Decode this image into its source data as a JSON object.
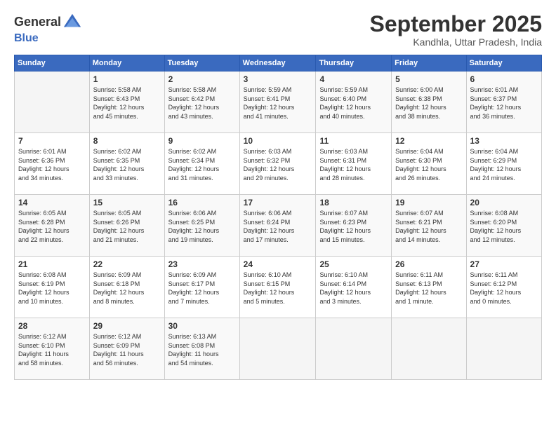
{
  "header": {
    "logo_line1": "General",
    "logo_line2": "Blue",
    "title": "September 2025",
    "location": "Kandhla, Uttar Pradesh, India"
  },
  "weekdays": [
    "Sunday",
    "Monday",
    "Tuesday",
    "Wednesday",
    "Thursday",
    "Friday",
    "Saturday"
  ],
  "weeks": [
    [
      {
        "day": "",
        "content": ""
      },
      {
        "day": "1",
        "content": "Sunrise: 5:58 AM\nSunset: 6:43 PM\nDaylight: 12 hours\nand 45 minutes."
      },
      {
        "day": "2",
        "content": "Sunrise: 5:58 AM\nSunset: 6:42 PM\nDaylight: 12 hours\nand 43 minutes."
      },
      {
        "day": "3",
        "content": "Sunrise: 5:59 AM\nSunset: 6:41 PM\nDaylight: 12 hours\nand 41 minutes."
      },
      {
        "day": "4",
        "content": "Sunrise: 5:59 AM\nSunset: 6:40 PM\nDaylight: 12 hours\nand 40 minutes."
      },
      {
        "day": "5",
        "content": "Sunrise: 6:00 AM\nSunset: 6:38 PM\nDaylight: 12 hours\nand 38 minutes."
      },
      {
        "day": "6",
        "content": "Sunrise: 6:01 AM\nSunset: 6:37 PM\nDaylight: 12 hours\nand 36 minutes."
      }
    ],
    [
      {
        "day": "7",
        "content": "Sunrise: 6:01 AM\nSunset: 6:36 PM\nDaylight: 12 hours\nand 34 minutes."
      },
      {
        "day": "8",
        "content": "Sunrise: 6:02 AM\nSunset: 6:35 PM\nDaylight: 12 hours\nand 33 minutes."
      },
      {
        "day": "9",
        "content": "Sunrise: 6:02 AM\nSunset: 6:34 PM\nDaylight: 12 hours\nand 31 minutes."
      },
      {
        "day": "10",
        "content": "Sunrise: 6:03 AM\nSunset: 6:32 PM\nDaylight: 12 hours\nand 29 minutes."
      },
      {
        "day": "11",
        "content": "Sunrise: 6:03 AM\nSunset: 6:31 PM\nDaylight: 12 hours\nand 28 minutes."
      },
      {
        "day": "12",
        "content": "Sunrise: 6:04 AM\nSunset: 6:30 PM\nDaylight: 12 hours\nand 26 minutes."
      },
      {
        "day": "13",
        "content": "Sunrise: 6:04 AM\nSunset: 6:29 PM\nDaylight: 12 hours\nand 24 minutes."
      }
    ],
    [
      {
        "day": "14",
        "content": "Sunrise: 6:05 AM\nSunset: 6:28 PM\nDaylight: 12 hours\nand 22 minutes."
      },
      {
        "day": "15",
        "content": "Sunrise: 6:05 AM\nSunset: 6:26 PM\nDaylight: 12 hours\nand 21 minutes."
      },
      {
        "day": "16",
        "content": "Sunrise: 6:06 AM\nSunset: 6:25 PM\nDaylight: 12 hours\nand 19 minutes."
      },
      {
        "day": "17",
        "content": "Sunrise: 6:06 AM\nSunset: 6:24 PM\nDaylight: 12 hours\nand 17 minutes."
      },
      {
        "day": "18",
        "content": "Sunrise: 6:07 AM\nSunset: 6:23 PM\nDaylight: 12 hours\nand 15 minutes."
      },
      {
        "day": "19",
        "content": "Sunrise: 6:07 AM\nSunset: 6:21 PM\nDaylight: 12 hours\nand 14 minutes."
      },
      {
        "day": "20",
        "content": "Sunrise: 6:08 AM\nSunset: 6:20 PM\nDaylight: 12 hours\nand 12 minutes."
      }
    ],
    [
      {
        "day": "21",
        "content": "Sunrise: 6:08 AM\nSunset: 6:19 PM\nDaylight: 12 hours\nand 10 minutes."
      },
      {
        "day": "22",
        "content": "Sunrise: 6:09 AM\nSunset: 6:18 PM\nDaylight: 12 hours\nand 8 minutes."
      },
      {
        "day": "23",
        "content": "Sunrise: 6:09 AM\nSunset: 6:17 PM\nDaylight: 12 hours\nand 7 minutes."
      },
      {
        "day": "24",
        "content": "Sunrise: 6:10 AM\nSunset: 6:15 PM\nDaylight: 12 hours\nand 5 minutes."
      },
      {
        "day": "25",
        "content": "Sunrise: 6:10 AM\nSunset: 6:14 PM\nDaylight: 12 hours\nand 3 minutes."
      },
      {
        "day": "26",
        "content": "Sunrise: 6:11 AM\nSunset: 6:13 PM\nDaylight: 12 hours\nand 1 minute."
      },
      {
        "day": "27",
        "content": "Sunrise: 6:11 AM\nSunset: 6:12 PM\nDaylight: 12 hours\nand 0 minutes."
      }
    ],
    [
      {
        "day": "28",
        "content": "Sunrise: 6:12 AM\nSunset: 6:10 PM\nDaylight: 11 hours\nand 58 minutes."
      },
      {
        "day": "29",
        "content": "Sunrise: 6:12 AM\nSunset: 6:09 PM\nDaylight: 11 hours\nand 56 minutes."
      },
      {
        "day": "30",
        "content": "Sunrise: 6:13 AM\nSunset: 6:08 PM\nDaylight: 11 hours\nand 54 minutes."
      },
      {
        "day": "",
        "content": ""
      },
      {
        "day": "",
        "content": ""
      },
      {
        "day": "",
        "content": ""
      },
      {
        "day": "",
        "content": ""
      }
    ]
  ]
}
